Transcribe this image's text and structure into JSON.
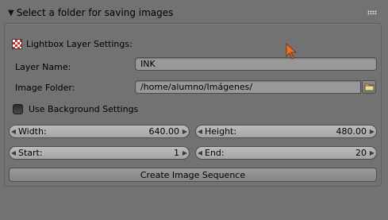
{
  "header": {
    "title": "Select a folder for saving images"
  },
  "panel": {
    "section_label": "Lightbox Layer Settings:",
    "layer_name": {
      "label": "Layer Name:",
      "value": "INK"
    },
    "image_folder": {
      "label": "Image Folder:",
      "value": "/home/alumno/Imágenes/"
    },
    "use_background": {
      "label": "Use Background Settings",
      "checked": false
    },
    "width": {
      "label": "Width:",
      "value": "640.00"
    },
    "height": {
      "label": "Height:",
      "value": "480.00"
    },
    "start": {
      "label": "Start:",
      "value": "1"
    },
    "end": {
      "label": "End:",
      "value": "20"
    },
    "create_button": "Create Image Sequence"
  },
  "colors": {
    "background": "#727272",
    "field": "#999999",
    "cursor": "#e8702a"
  },
  "icons": {
    "collapse": "triangle-down-icon",
    "layer": "checker-icon",
    "folder": "folder-icon",
    "cursor": "mouse-pointer-icon"
  }
}
